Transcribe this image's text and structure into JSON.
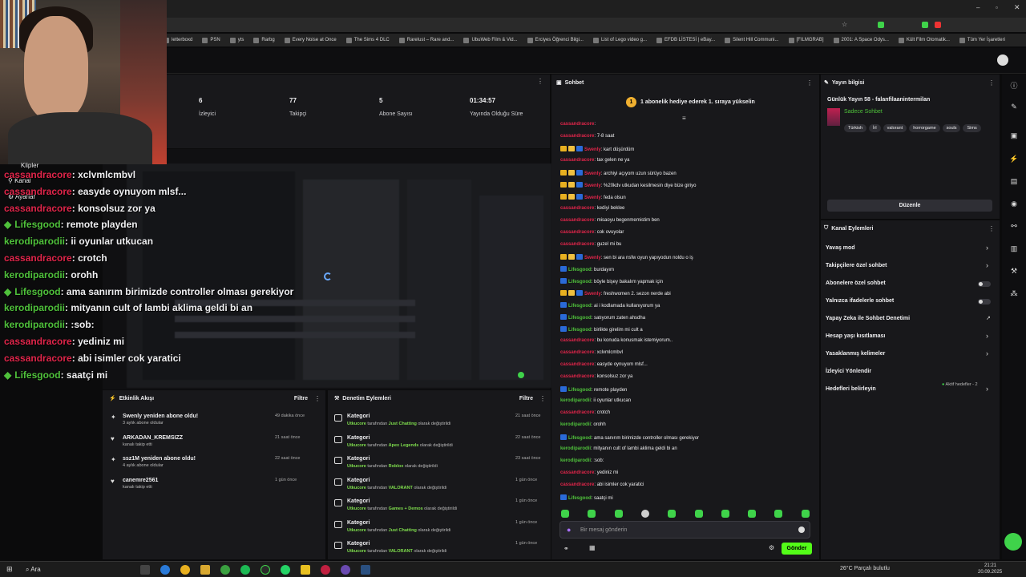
{
  "bookmarks": [
    "letterboxd",
    "PSN",
    "yts",
    "Rarbg",
    "Every Noise at Once",
    "The Sims 4 DLC",
    "Rarelust – Rare and...",
    "UbuWeb Film & Vid...",
    "Erciyes Öğrenci Bilgi...",
    "List of Lego video g...",
    "EFDB LİSTESİ | eBay...",
    "Silent Hill Communi...",
    "[FILMGRAB]",
    "2001: A Space Odys...",
    "Kült Film Otomatik...",
    "Tüm Yer İşaretleri"
  ],
  "overlay": {
    "menu": {
      "clips": "Klipler",
      "channel": "Kanal",
      "settings": "Ayarlar"
    },
    "lines": [
      {
        "user": "cassandracore",
        "msg": ": xclvmlcmbvl",
        "color": "red",
        "badge": false
      },
      {
        "user": "cassandracore",
        "msg": ": easyde oynuyom mlsf...",
        "color": "red",
        "badge": false
      },
      {
        "user": "cassandracore",
        "msg": ": konsolsuz zor ya",
        "color": "red",
        "badge": false
      },
      {
        "user": "Lifesgood",
        "msg": ": remote playden",
        "color": "green",
        "badge": true
      },
      {
        "user": "kerodiparodii",
        "msg": ": ii oyunlar utkucan",
        "color": "green",
        "badge": false
      },
      {
        "user": "cassandracore",
        "msg": ": crotch",
        "color": "red",
        "badge": false
      },
      {
        "user": "kerodiparodii",
        "msg": ": orohh",
        "color": "green",
        "badge": false
      },
      {
        "user": "Lifesgood",
        "msg": ": ama sanırım birimizde controller olması gerekiyor",
        "color": "green",
        "badge": true
      },
      {
        "user": "kerodiparodii",
        "msg": ": mityanın cult of lambi aklima geldi bi an",
        "color": "green",
        "badge": false
      },
      {
        "user": "kerodiparodii",
        "msg": ": :sob:",
        "color": "green",
        "badge": false
      },
      {
        "user": "cassandracore",
        "msg": ": yediniz mi",
        "color": "red",
        "badge": false
      },
      {
        "user": "cassandracore",
        "msg": ": abi isimler cok yaratici",
        "color": "red",
        "badge": false
      },
      {
        "user": "Lifesgood",
        "msg": ": saatçi mi",
        "color": "green",
        "badge": true
      }
    ]
  },
  "stats": [
    {
      "value": "6",
      "label": "İzleyici"
    },
    {
      "value": "77",
      "label": "Takipçi"
    },
    {
      "value": "5",
      "label": "Abone Sayısı"
    },
    {
      "value": "01:34:57",
      "label": "Yayında Olduğu Süre"
    }
  ],
  "activity": {
    "title": "Etkinlik Akışı",
    "filter": "Filtre",
    "items": [
      {
        "title": "Swenly yeniden abone oldu!",
        "sub": "3 aylık abone oldular",
        "time": "49 dakika önce",
        "icon": "star"
      },
      {
        "title": "ARKADAN_KREMSIZZ",
        "sub": "kanalı takip etti",
        "time": "21 saat önce",
        "icon": "heart"
      },
      {
        "title": "ssz1M yeniden abone oldu!",
        "sub": "4 aylık abone oldular",
        "time": "22 saat önce",
        "icon": "star"
      },
      {
        "title": "canemre2561",
        "sub": "kanalı takip etti",
        "time": "1 gün önce",
        "icon": "heart"
      }
    ]
  },
  "moderation": {
    "title": "Denetim Eylemleri",
    "filter": "Filtre",
    "items": [
      {
        "title": "Kategori",
        "by": "Utkucore",
        "mid": " tarafından ",
        "cat": "Just Chatting",
        "end": " olarak değiştirildi",
        "time": "21 saat önce"
      },
      {
        "title": "Kategori",
        "by": "Utkucore",
        "mid": " tarafından ",
        "cat": "Apex Legends",
        "end": " olarak değiştirildi",
        "time": "22 saat önce"
      },
      {
        "title": "Kategori",
        "by": "Utkucore",
        "mid": " tarafından ",
        "cat": "Roblox",
        "end": " olarak değiştirildi",
        "time": "23 saat önce"
      },
      {
        "title": "Kategori",
        "by": "Utkucore",
        "mid": " tarafından ",
        "cat": "VALORANT",
        "end": " olarak değiştirildi",
        "time": "1 gün önce"
      },
      {
        "title": "Kategori",
        "by": "Utkucore",
        "mid": " tarafından ",
        "cat": "Games + Demos",
        "end": " olarak değiştirildi",
        "time": "1 gün önce"
      },
      {
        "title": "Kategori",
        "by": "Utkucore",
        "mid": " tarafından ",
        "cat": "Just Chatting",
        "end": " olarak değiştirildi",
        "time": "1 gün önce"
      },
      {
        "title": "Kategori",
        "by": "Utkucore",
        "mid": " tarafından ",
        "cat": "VALORANT",
        "end": " olarak değiştirildi",
        "time": "1 gün önce"
      }
    ]
  },
  "chat": {
    "title": "Sohbet",
    "pinned": "1 abonelik hediye ederek 1. sıraya yükselin",
    "placeholder": "Bir mesaj gönderin",
    "send": "Gönder",
    "messages": [
      {
        "user": "cassandracore",
        "msg": ": ",
        "color": "#e0254a",
        "badges": 0
      },
      {
        "user": "cassandracore",
        "msg": ": 7-8 saat",
        "color": "#e0254a",
        "badges": 0
      },
      {
        "user": "Swenly",
        "msg": ": kart düşürdüm",
        "color": "#e0254a",
        "badges": 3
      },
      {
        "user": "cassandracore",
        "msg": ": tax gelen ne ya",
        "color": "#e0254a",
        "badges": 0
      },
      {
        "user": "Swenly",
        "msg": ": archiyi açıyom uzun sürüyo bazen",
        "color": "#e0254a",
        "badges": 3
      },
      {
        "user": "Swenly",
        "msg": ": %20kdv utkudan kesilmesin diye bize giriyo",
        "color": "#e0254a",
        "badges": 3
      },
      {
        "user": "Swenly",
        "msg": ": feda olsun",
        "color": "#e0254a",
        "badges": 3
      },
      {
        "user": "cassandracore",
        "msg": ": kediyi beklee",
        "color": "#e0254a",
        "badges": 0
      },
      {
        "user": "cassandracore",
        "msg": ": misaoyu begenmemistim ben",
        "color": "#e0254a",
        "badges": 0
      },
      {
        "user": "cassandracore",
        "msg": ": cok ovuyolar",
        "color": "#e0254a",
        "badges": 0
      },
      {
        "user": "cassandracore",
        "msg": ": guzel mi bu",
        "color": "#e0254a",
        "badges": 0
      },
      {
        "user": "Swenly",
        "msg": ": sen bi ara nsfw oyun yapıyodun noldu o iş",
        "color": "#e0254a",
        "badges": 3
      },
      {
        "user": "Lifesgood",
        "msg": ": burdayım",
        "color": "#4fc13b",
        "badges": 1
      },
      {
        "user": "Lifesgood",
        "msg": ": böyle bişey bakalım yapmak için",
        "color": "#4fc13b",
        "badges": 1
      },
      {
        "user": "Swenly",
        "msg": ": freshwomen 2. sezon nerde abi",
        "color": "#e0254a",
        "badges": 3
      },
      {
        "user": "Lifesgood",
        "msg": ": ai i kodlamada kullanıyorum ya",
        "color": "#4fc13b",
        "badges": 1
      },
      {
        "user": "Lifesgood",
        "msg": ": satıyorum zaten ahsdha",
        "color": "#4fc13b",
        "badges": 1
      },
      {
        "user": "Lifesgood",
        "msg": ": birlikte girelim mi cult a",
        "color": "#4fc13b",
        "badges": 1
      },
      {
        "user": "cassandracore",
        "msg": ": bu konuda konusmak istemiyorum..",
        "color": "#e0254a",
        "badges": 0
      },
      {
        "user": "cassandracore",
        "msg": ": xclvmlcmbvl",
        "color": "#e0254a",
        "badges": 0
      },
      {
        "user": "cassandracore",
        "msg": ": easyde oynuyom mlsf...",
        "color": "#e0254a",
        "badges": 0
      },
      {
        "user": "cassandracore",
        "msg": ": konsolsuz zor ya",
        "color": "#e0254a",
        "badges": 0
      },
      {
        "user": "Lifesgood",
        "msg": ": remote playden",
        "color": "#4fc13b",
        "badges": 1
      },
      {
        "user": "kerodiparodii",
        "msg": ": ii oyunlar utkucan",
        "color": "#4fc13b",
        "badges": 0
      },
      {
        "user": "cassandracore",
        "msg": ": crotch",
        "color": "#e0254a",
        "badges": 0
      },
      {
        "user": "kerodiparodii",
        "msg": ": orohh",
        "color": "#4fc13b",
        "badges": 0
      },
      {
        "user": "Lifesgood",
        "msg": ": ama sanırım birimizde controller olması gerekiyor",
        "color": "#4fc13b",
        "badges": 1
      },
      {
        "user": "kerodiparodii",
        "msg": ": mityanın cult of lambi aklima geldi bi an",
        "color": "#4fc13b",
        "badges": 0
      },
      {
        "user": "kerodiparodii",
        "msg": ": :sob:",
        "color": "#4fc13b",
        "badges": 0
      },
      {
        "user": "cassandracore",
        "msg": ": yediniz mi",
        "color": "#e0254a",
        "badges": 0
      },
      {
        "user": "cassandracore",
        "msg": ": abi isimler cok yaratici",
        "color": "#e0254a",
        "badges": 0
      },
      {
        "user": "Lifesgood",
        "msg": ": saatçi mi",
        "color": "#4fc13b",
        "badges": 1
      }
    ]
  },
  "streaminfo": {
    "title": "Yayın bilgisi",
    "stream_title": "Günlük Yayın 58 - falanfilaanintermilan",
    "category": "Sadece Sohbet",
    "tags": [
      "Türkish",
      "İrl",
      "valorant",
      "horrorgame",
      "souls",
      "Sims"
    ],
    "edit": "Düzenle"
  },
  "channel_actions": {
    "title": "Kanal Eylemleri",
    "items": [
      {
        "label": "Yavaş mod",
        "kind": "chevron"
      },
      {
        "label": "Takipçilere özel sohbet",
        "kind": "chevron"
      },
      {
        "label": "Abonelere özel sohbet",
        "kind": "toggle"
      },
      {
        "label": "Yalnızca ifadelerle sohbet",
        "kind": "toggle"
      },
      {
        "label": "Yapay Zeka ile Sohbet Denetimi",
        "kind": "external"
      },
      {
        "label": "Hesap yaşı kısıtlaması",
        "kind": "chevron"
      },
      {
        "label": "Yasaklanmış kelimeler",
        "kind": "chevron"
      },
      {
        "label": "İzleyici Yönlendir",
        "kind": "none"
      },
      {
        "label": "Hedefleri belirleyin",
        "kind": "chevron"
      }
    ],
    "goals_status": "Aktif hedefler - 2"
  },
  "taskbar": {
    "search": "Ara",
    "weather": "26°C  Parçalı bulutlu",
    "time": "21:21",
    "date": "20.09.2025"
  }
}
